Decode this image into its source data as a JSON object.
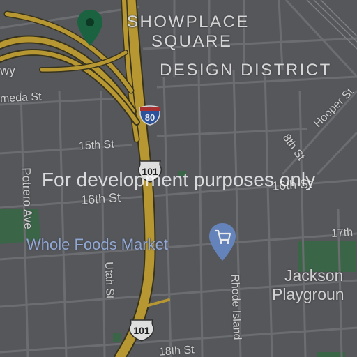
{
  "map": {
    "districts": {
      "showplace_line1": "SHOWPLACE",
      "showplace_line2": "SQUARE",
      "design_district": "DESIGN DISTRICT"
    },
    "streets": {
      "alameda": "meda St",
      "potrero": "Potrero Ave",
      "fifteenth": "15th St",
      "sixteenth_west": "16th St",
      "sixteenth_east": "16th St",
      "utah": "Utah St",
      "eighth": "8th St",
      "hooper": "Hooper St",
      "seventeenth": "17th",
      "rhode_island": "Rhode Island",
      "eighteenth": "18th St",
      "freeway_fragment": "wy"
    },
    "poi": {
      "whole_foods": "Whole Foods Market",
      "jackson_line1": "Jackson",
      "jackson_line2": "Playgroun"
    },
    "shields": {
      "i80": "80",
      "us101_upper": "101",
      "us101_lower": "101"
    },
    "watermark": "For development purposes only",
    "colors": {
      "land": "#5d5f63",
      "highway": "#c6a437",
      "park": "#3f7552",
      "poi_blue": "#7b99d3",
      "pin_green": "#1e6b46"
    }
  }
}
